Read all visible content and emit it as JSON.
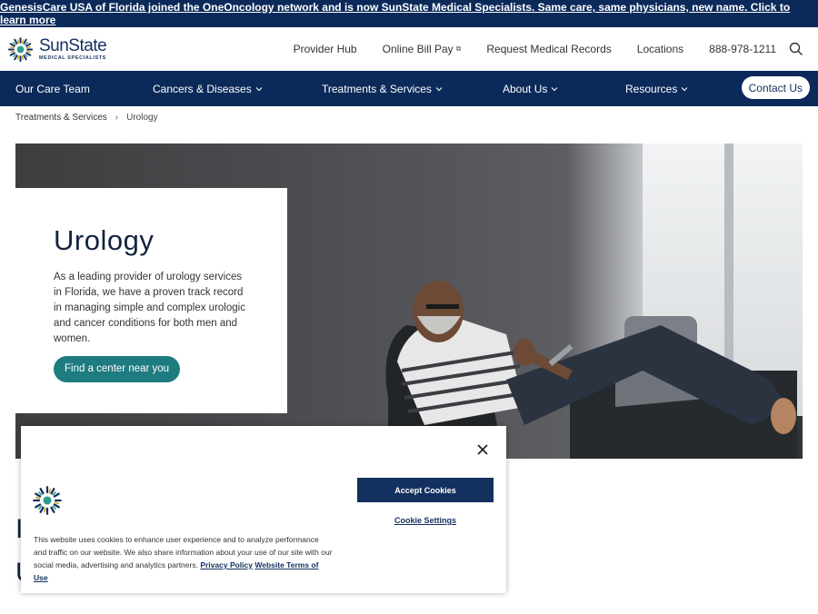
{
  "banner": {
    "text": "GenesisCare USA of Florida joined the OneOncology network and is now SunState Medical Specialists. Same care, same physicians, new name. Click to learn more"
  },
  "header": {
    "logo_name": "SunState",
    "logo_sub": "MEDICAL SPECIALISTS",
    "links": [
      "Provider Hub",
      "Online Bill Pay",
      "Request Medical Records",
      "Locations",
      "888-978-1211"
    ]
  },
  "nav": {
    "items": [
      "Our Care Team",
      "Cancers & Diseases",
      "Treatments & Services",
      "About Us",
      "Resources"
    ],
    "contact": "Contact Us"
  },
  "breadcrumb": {
    "parent": "Treatments & Services",
    "current": "Urology"
  },
  "hero": {
    "title": "Urology",
    "description": "As a leading provider of urology services in Florida, we have a proven track record in managing simple and complex urologic and cancer conditions for both men and women.",
    "cta": "Find a center near you"
  },
  "partial": {
    "line1": "I",
    "line2": "U"
  },
  "cookie": {
    "text": "This website uses cookies to enhance user experience and to analyze performance and traffic on our website. We also share information about your use of our site with our social media, advertising and analytics partners.",
    "privacy_link": "Privacy Policy",
    "terms_link_1": "Website",
    "terms_link_2": "Terms of Use",
    "accept": "Accept Cookies",
    "settings": "Cookie Settings"
  },
  "colors": {
    "navy": "#0b2a5a",
    "teal": "#1e7b80",
    "button_navy": "#14305e"
  }
}
